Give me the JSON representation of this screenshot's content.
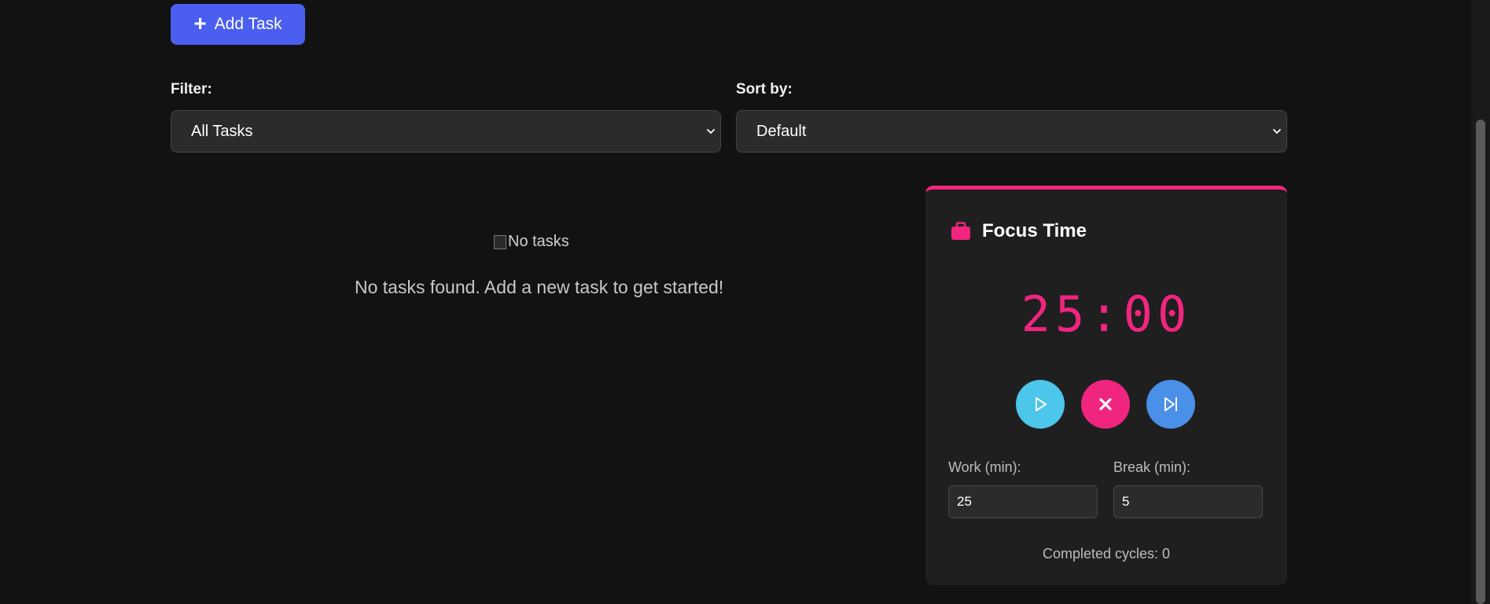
{
  "toolbar": {
    "add_task_label": "Add Task"
  },
  "filter": {
    "label": "Filter:",
    "selected": "All Tasks"
  },
  "sort": {
    "label": "Sort by:",
    "selected": "Default"
  },
  "empty_state": {
    "image_alt": "No tasks",
    "message": "No tasks found. Add a new task to get started!"
  },
  "focus": {
    "title": "Focus Time",
    "time": "25:00",
    "work_label": "Work (min):",
    "work_value": "25",
    "break_label": "Break (min):",
    "break_value": "5",
    "cycles_text": "Completed cycles: 0"
  },
  "colors": {
    "accent": "#f0257f",
    "primary_button": "#4a5ff0",
    "play_button": "#4cc6ea",
    "reset_button": "#f0257f",
    "skip_button": "#4a8fe8",
    "background": "#121212"
  },
  "icons": {
    "add": "plus-icon",
    "focus": "briefcase-icon",
    "play": "play-icon",
    "reset": "close-icon",
    "skip": "skip-next-icon",
    "select": "chevron-down-icon"
  }
}
